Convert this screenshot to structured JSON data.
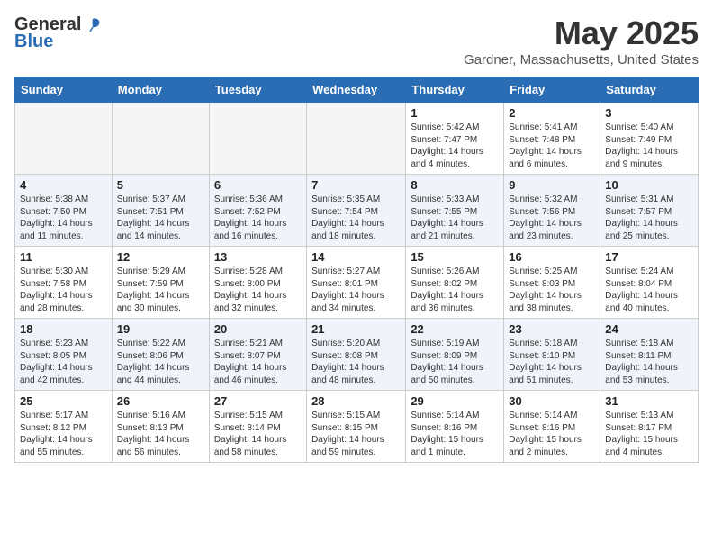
{
  "header": {
    "logo_general": "General",
    "logo_blue": "Blue",
    "month_title": "May 2025",
    "location": "Gardner, Massachusetts, United States"
  },
  "days_of_week": [
    "Sunday",
    "Monday",
    "Tuesday",
    "Wednesday",
    "Thursday",
    "Friday",
    "Saturday"
  ],
  "weeks": [
    [
      {
        "day": "",
        "info": ""
      },
      {
        "day": "",
        "info": ""
      },
      {
        "day": "",
        "info": ""
      },
      {
        "day": "",
        "info": ""
      },
      {
        "day": "1",
        "info": "Sunrise: 5:42 AM\nSunset: 7:47 PM\nDaylight: 14 hours\nand 4 minutes."
      },
      {
        "day": "2",
        "info": "Sunrise: 5:41 AM\nSunset: 7:48 PM\nDaylight: 14 hours\nand 6 minutes."
      },
      {
        "day": "3",
        "info": "Sunrise: 5:40 AM\nSunset: 7:49 PM\nDaylight: 14 hours\nand 9 minutes."
      }
    ],
    [
      {
        "day": "4",
        "info": "Sunrise: 5:38 AM\nSunset: 7:50 PM\nDaylight: 14 hours\nand 11 minutes."
      },
      {
        "day": "5",
        "info": "Sunrise: 5:37 AM\nSunset: 7:51 PM\nDaylight: 14 hours\nand 14 minutes."
      },
      {
        "day": "6",
        "info": "Sunrise: 5:36 AM\nSunset: 7:52 PM\nDaylight: 14 hours\nand 16 minutes."
      },
      {
        "day": "7",
        "info": "Sunrise: 5:35 AM\nSunset: 7:54 PM\nDaylight: 14 hours\nand 18 minutes."
      },
      {
        "day": "8",
        "info": "Sunrise: 5:33 AM\nSunset: 7:55 PM\nDaylight: 14 hours\nand 21 minutes."
      },
      {
        "day": "9",
        "info": "Sunrise: 5:32 AM\nSunset: 7:56 PM\nDaylight: 14 hours\nand 23 minutes."
      },
      {
        "day": "10",
        "info": "Sunrise: 5:31 AM\nSunset: 7:57 PM\nDaylight: 14 hours\nand 25 minutes."
      }
    ],
    [
      {
        "day": "11",
        "info": "Sunrise: 5:30 AM\nSunset: 7:58 PM\nDaylight: 14 hours\nand 28 minutes."
      },
      {
        "day": "12",
        "info": "Sunrise: 5:29 AM\nSunset: 7:59 PM\nDaylight: 14 hours\nand 30 minutes."
      },
      {
        "day": "13",
        "info": "Sunrise: 5:28 AM\nSunset: 8:00 PM\nDaylight: 14 hours\nand 32 minutes."
      },
      {
        "day": "14",
        "info": "Sunrise: 5:27 AM\nSunset: 8:01 PM\nDaylight: 14 hours\nand 34 minutes."
      },
      {
        "day": "15",
        "info": "Sunrise: 5:26 AM\nSunset: 8:02 PM\nDaylight: 14 hours\nand 36 minutes."
      },
      {
        "day": "16",
        "info": "Sunrise: 5:25 AM\nSunset: 8:03 PM\nDaylight: 14 hours\nand 38 minutes."
      },
      {
        "day": "17",
        "info": "Sunrise: 5:24 AM\nSunset: 8:04 PM\nDaylight: 14 hours\nand 40 minutes."
      }
    ],
    [
      {
        "day": "18",
        "info": "Sunrise: 5:23 AM\nSunset: 8:05 PM\nDaylight: 14 hours\nand 42 minutes."
      },
      {
        "day": "19",
        "info": "Sunrise: 5:22 AM\nSunset: 8:06 PM\nDaylight: 14 hours\nand 44 minutes."
      },
      {
        "day": "20",
        "info": "Sunrise: 5:21 AM\nSunset: 8:07 PM\nDaylight: 14 hours\nand 46 minutes."
      },
      {
        "day": "21",
        "info": "Sunrise: 5:20 AM\nSunset: 8:08 PM\nDaylight: 14 hours\nand 48 minutes."
      },
      {
        "day": "22",
        "info": "Sunrise: 5:19 AM\nSunset: 8:09 PM\nDaylight: 14 hours\nand 50 minutes."
      },
      {
        "day": "23",
        "info": "Sunrise: 5:18 AM\nSunset: 8:10 PM\nDaylight: 14 hours\nand 51 minutes."
      },
      {
        "day": "24",
        "info": "Sunrise: 5:18 AM\nSunset: 8:11 PM\nDaylight: 14 hours\nand 53 minutes."
      }
    ],
    [
      {
        "day": "25",
        "info": "Sunrise: 5:17 AM\nSunset: 8:12 PM\nDaylight: 14 hours\nand 55 minutes."
      },
      {
        "day": "26",
        "info": "Sunrise: 5:16 AM\nSunset: 8:13 PM\nDaylight: 14 hours\nand 56 minutes."
      },
      {
        "day": "27",
        "info": "Sunrise: 5:15 AM\nSunset: 8:14 PM\nDaylight: 14 hours\nand 58 minutes."
      },
      {
        "day": "28",
        "info": "Sunrise: 5:15 AM\nSunset: 8:15 PM\nDaylight: 14 hours\nand 59 minutes."
      },
      {
        "day": "29",
        "info": "Sunrise: 5:14 AM\nSunset: 8:16 PM\nDaylight: 15 hours\nand 1 minute."
      },
      {
        "day": "30",
        "info": "Sunrise: 5:14 AM\nSunset: 8:16 PM\nDaylight: 15 hours\nand 2 minutes."
      },
      {
        "day": "31",
        "info": "Sunrise: 5:13 AM\nSunset: 8:17 PM\nDaylight: 15 hours\nand 4 minutes."
      }
    ]
  ]
}
